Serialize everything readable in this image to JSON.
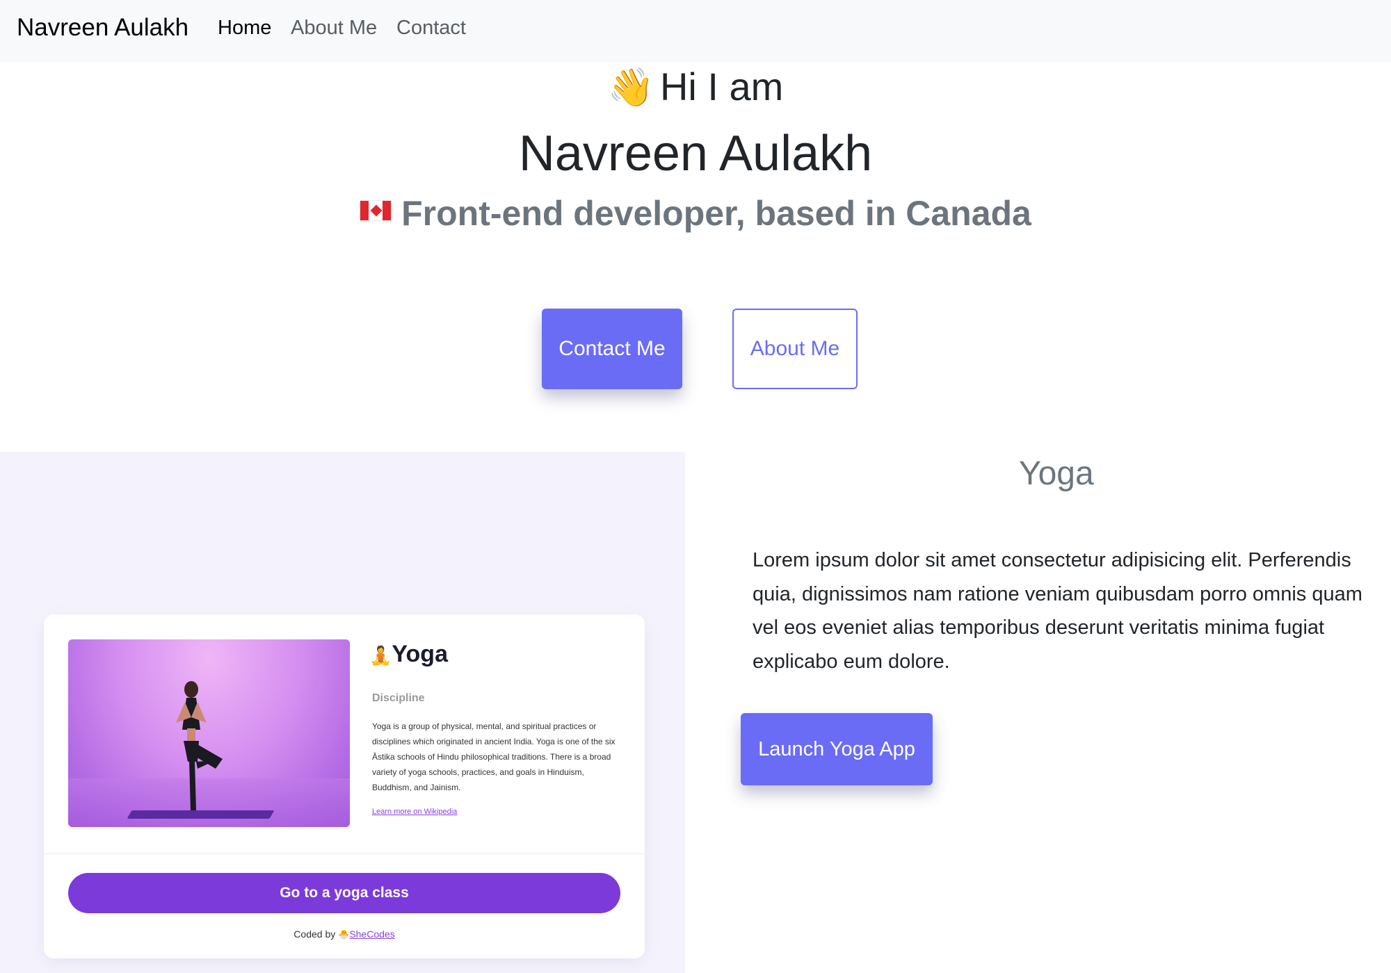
{
  "navbar": {
    "brand": "Navreen Aulakh",
    "links": [
      "Home",
      "About Me",
      "Contact"
    ]
  },
  "hero": {
    "greeting": "Hi I am",
    "greeting_icon": "waving-hand-emoji",
    "name": "Navreen Aulakh",
    "role": "Front-end developer, based in Canada",
    "role_icon": "canada-flag-emoji",
    "contact_button": "Contact Me",
    "about_button": "About Me"
  },
  "project": {
    "preview": {
      "title": "Yoga",
      "title_icon": "person-in-lotus-position-emoji",
      "subtitle": "Discipline",
      "description": "Yoga is a group of physical, mental, and spiritual practices or disciplines which originated in ancient India. Yoga is one of the six Āstika schools of Hindu philosophical traditions. There is a broad variety of yoga schools, practices, and goals in Hinduism, Buddhism, and Jainism.",
      "wiki_link": "Learn more on Wikipedia",
      "cta": "Go to a yoga class",
      "coded_by": "Coded by",
      "coded_by_icon": "hatching-chick-emoji",
      "coded_by_link": "SheCodes"
    },
    "heading": "Yoga",
    "description": "Lorem ipsum dolor sit amet consectetur adipisicing elit. Perferendis quia, dignissimos nam ratione veniam quibusdam porro omnis quam vel eos eveniet alias temporibus deserunt veritatis minima fugiat explicabo eum dolore.",
    "launch_button": "Launch Yoga App"
  },
  "colors": {
    "accent": "#6a6cf6",
    "card_button": "#7c3adb",
    "muted_text": "#6c757d",
    "panel_bg": "#f4f3fd",
    "navbar_bg": "#f8f9fa"
  }
}
